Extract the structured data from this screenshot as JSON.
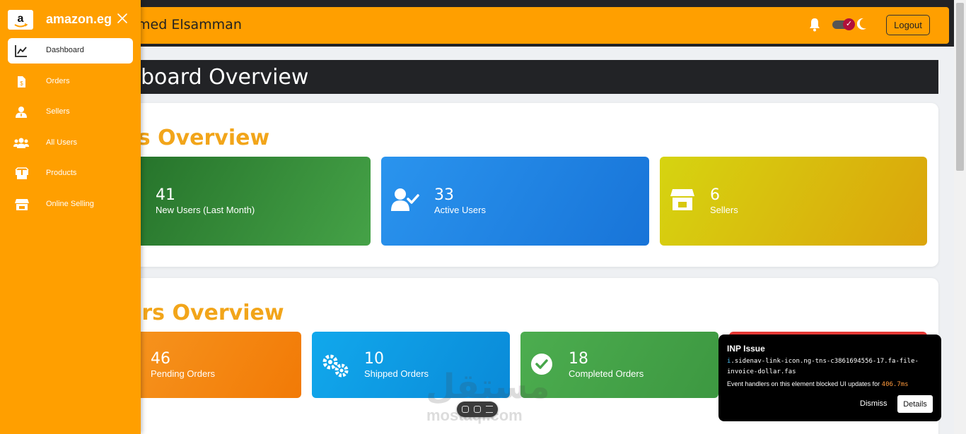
{
  "app": {
    "brand": "amazon.eg",
    "logo_glyph": "a"
  },
  "header": {
    "user_name": "hmed Elsamman",
    "logout_label": "Logout"
  },
  "page": {
    "title": "hboard Overview"
  },
  "sidebar": {
    "items": [
      {
        "label": "Dashboard",
        "icon": "chart-line-icon",
        "active": true
      },
      {
        "label": "Orders",
        "icon": "file-invoice-dollar-icon",
        "active": false
      },
      {
        "label": "Sellers",
        "icon": "user-tie-icon",
        "active": false
      },
      {
        "label": "All Users",
        "icon": "users-icon",
        "active": false
      },
      {
        "label": "Products",
        "icon": "boxes-icon",
        "active": false
      },
      {
        "label": "Online Selling",
        "icon": "store-icon",
        "active": false
      }
    ]
  },
  "users_overview": {
    "title": "rs Overview",
    "cards": [
      {
        "value": "41",
        "label": "New Users (Last Month)"
      },
      {
        "value": "33",
        "label": "Active Users",
        "icon": "user-check-icon"
      },
      {
        "value": "6",
        "label": "Sellers",
        "icon": "store-icon"
      }
    ]
  },
  "orders_overview": {
    "title": "ers Overview",
    "cards": [
      {
        "value": "46",
        "label": "Pending Orders"
      },
      {
        "value": "10",
        "label": "Shipped Orders",
        "icon": "cogs-icon"
      },
      {
        "value": "18",
        "label": "Completed Orders",
        "icon": "check-circle-icon"
      }
    ]
  },
  "inp_popup": {
    "title": "INP Issue",
    "prefix": "i",
    "selector": ".sidenav-link-icon.ng-tns-c3861694556-17.fa-file-invoice-dollar.fas",
    "message": "Event handlers on this element blocked UI updates for",
    "duration": "406.7ms",
    "dismiss_label": "Dismiss",
    "details_label": "Details"
  },
  "watermark": {
    "line1": "مستقل",
    "line2": "mostaql.com"
  },
  "colors": {
    "accent": "#ff9f00",
    "heading": "#f2a51a",
    "dark": "#222326"
  }
}
